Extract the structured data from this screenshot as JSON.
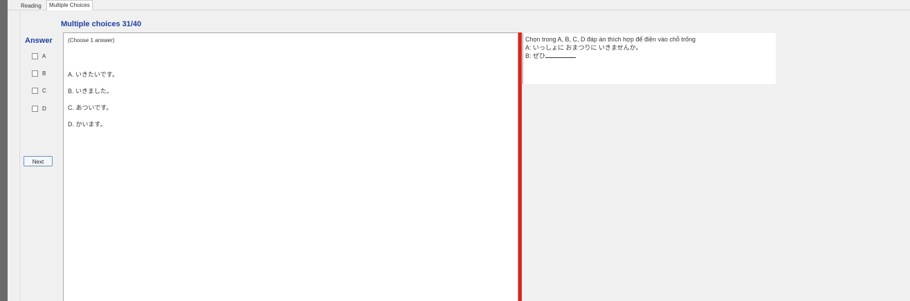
{
  "tabs": [
    {
      "label": "Reading",
      "active": false
    },
    {
      "label": "Multiple Choices",
      "active": true
    }
  ],
  "header": {
    "title": "Multiple choices 31/40"
  },
  "answer_panel": {
    "heading": "Answer",
    "options": [
      "A",
      "B",
      "C",
      "D"
    ],
    "next_label": "Next"
  },
  "question": {
    "instruction": "(Choose 1 answer)",
    "choices": [
      "A. いきたいです。",
      "B. いきました。",
      "C. あついです。",
      "D. かいます。"
    ]
  },
  "prompt": {
    "lines": [
      "Chọn trong A, B, C, D đáp án thích hợp để điền vào chỗ trống",
      "A:  いっしょに  おまつりに  いきませんか。",
      "B:  ぜひ"
    ]
  },
  "colors": {
    "accent": "#1f3fa0",
    "divider": "#e0231b"
  }
}
